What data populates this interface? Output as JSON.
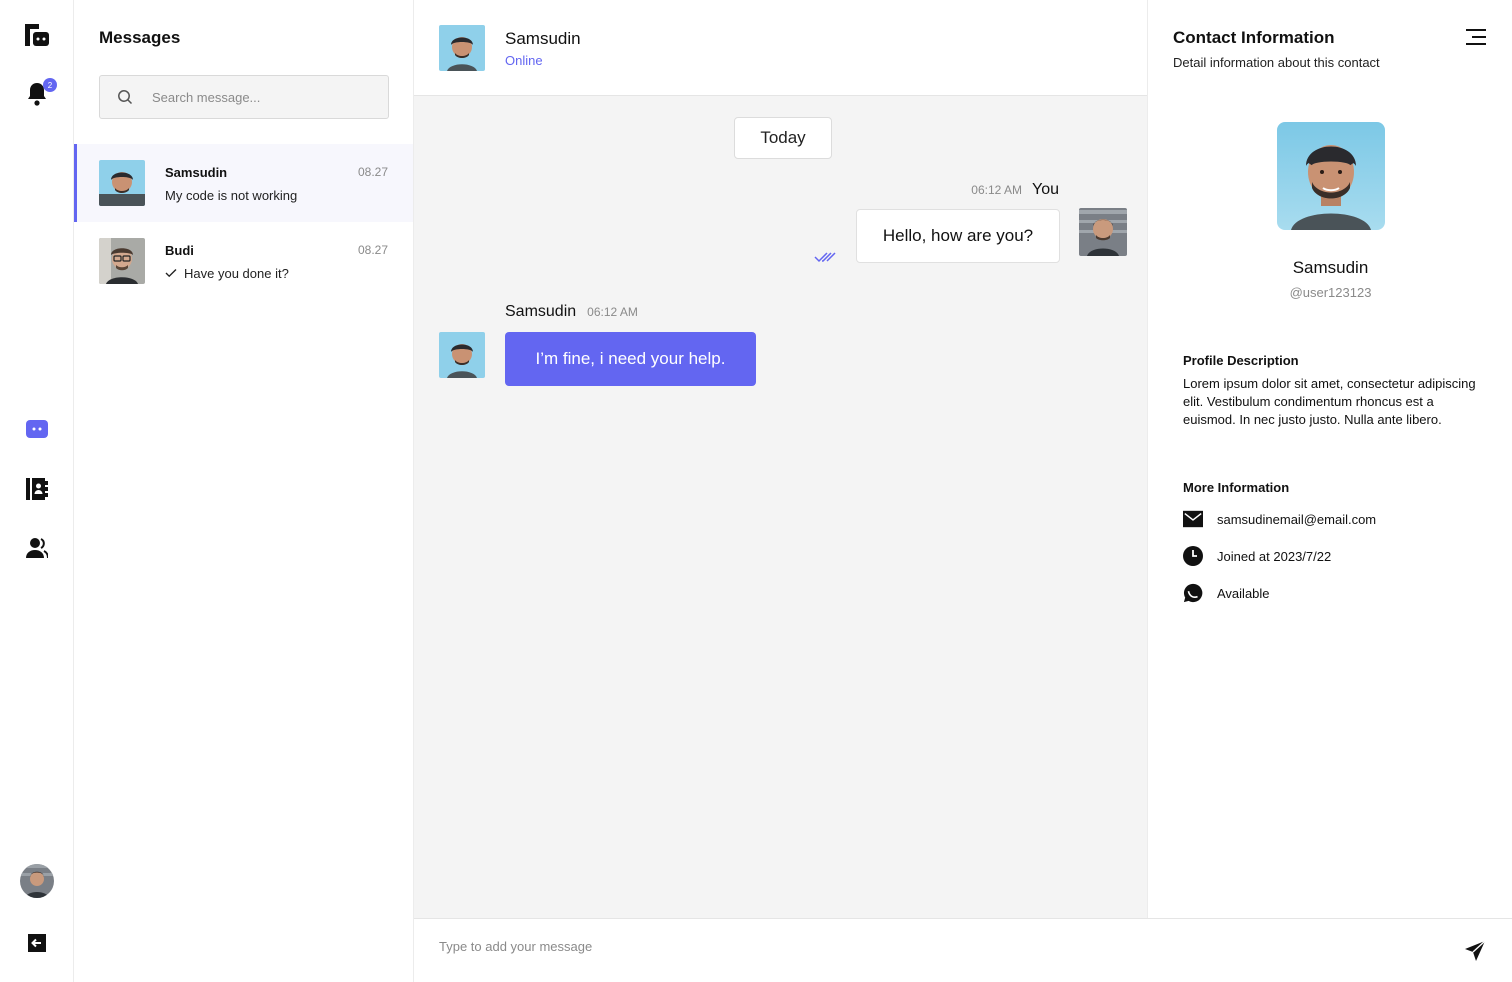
{
  "rail": {
    "notification_count": "2"
  },
  "messages": {
    "title": "Messages",
    "search_placeholder": "Search message...",
    "conversations": [
      {
        "name": "Samsudin",
        "time": "08.27",
        "preview": "My code is not working",
        "active": true
      },
      {
        "name": "Budi",
        "time": "08.27",
        "preview": "Have you done it?",
        "active": false
      }
    ]
  },
  "chat": {
    "contact_name": "Samsudin",
    "status": "Online",
    "date_divider": "Today",
    "outgoing": {
      "time": "06:12 AM",
      "sender": "You",
      "text": "Hello, how are you?"
    },
    "incoming": {
      "sender": "Samsudin",
      "time": "06:12 AM",
      "text": "I’m fine, i need  your help."
    },
    "composer_placeholder": "Type to add your message"
  },
  "contact": {
    "title": "Contact Information",
    "subtitle": "Detail information about this contact",
    "name": "Samsudin",
    "username": "@user123123",
    "profile_heading": "Profile Description",
    "profile_text": "Lorem ipsum dolor sit amet, consectetur adipiscing elit. Vestibulum condimentum rhoncus est a euismod. In nec justo justo. Nulla ante libero.",
    "more_heading": "More Information",
    "email": "samsudinemail@email.com",
    "joined": "Joined at 2023/7/22",
    "availability": "Available"
  },
  "colors": {
    "accent": "#6366f1",
    "chat_bg": "#f4f4f4",
    "muted": "#8a8a8a"
  },
  "icons": [
    "logo-icon",
    "bell-icon",
    "chat-icon",
    "contacts-book-icon",
    "users-icon",
    "logout-icon",
    "search-icon",
    "check-icon",
    "double-check-icon",
    "send-icon",
    "menu-icon",
    "mail-icon",
    "clock-icon",
    "whatsapp-icon"
  ]
}
